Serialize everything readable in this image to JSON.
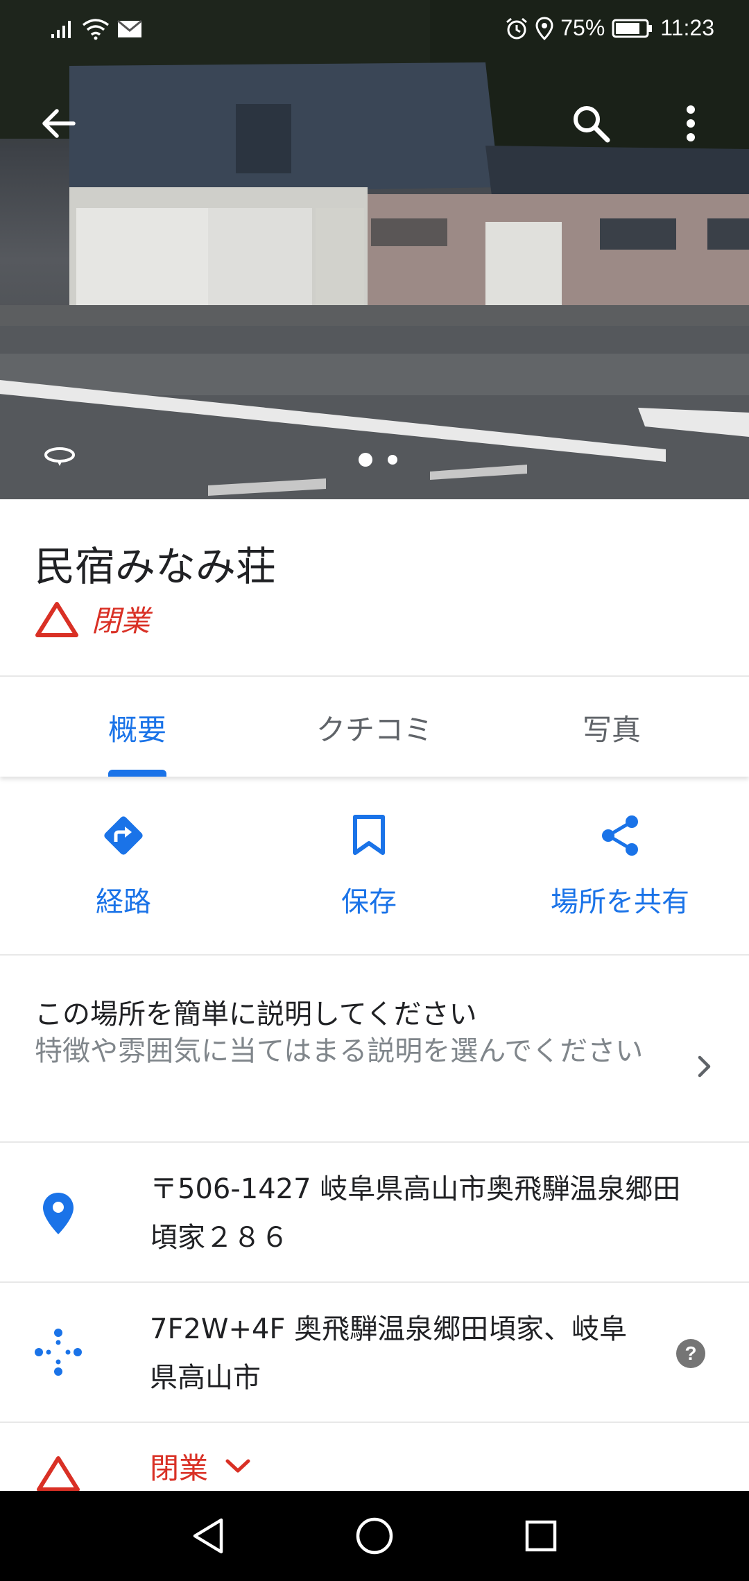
{
  "status_bar": {
    "battery_percent": "75%",
    "time": "11:23",
    "icons": [
      "signal-icon",
      "wifi-icon",
      "mail-icon",
      "alarm-icon",
      "location-icon",
      "battery-icon"
    ]
  },
  "hero": {
    "photo_count": 2,
    "active_photo": 1,
    "icons": [
      "back-arrow-icon",
      "search-icon",
      "more-vert-icon",
      "street-view-icon"
    ]
  },
  "place": {
    "name": "民宿みなみ荘",
    "status": "閉業"
  },
  "tabs": [
    {
      "label": "概要",
      "active": true
    },
    {
      "label": "クチコミ",
      "active": false
    },
    {
      "label": "写真",
      "active": false
    }
  ],
  "actions": [
    {
      "label": "経路",
      "icon": "directions-icon"
    },
    {
      "label": "保存",
      "icon": "bookmark-icon"
    },
    {
      "label": "場所を共有",
      "icon": "share-icon"
    }
  ],
  "describe": {
    "title": "この場所を簡単に説明してください",
    "subtitle": "特徴や雰囲気に当てはまる説明を選んでください"
  },
  "info": {
    "address_line1": "〒506-1427 岐阜県高山市奥飛騨温泉郷田",
    "address_line2": "頃家２８６",
    "pluscode_line1": "7F2W+4F 奥飛騨温泉郷田頃家、岐阜",
    "pluscode_line2": "県高山市",
    "closed_label": "閉業"
  },
  "colors": {
    "accent": "#1a73e8",
    "closed_red": "#d93025",
    "text_primary": "#202124",
    "text_secondary": "#80868b"
  }
}
